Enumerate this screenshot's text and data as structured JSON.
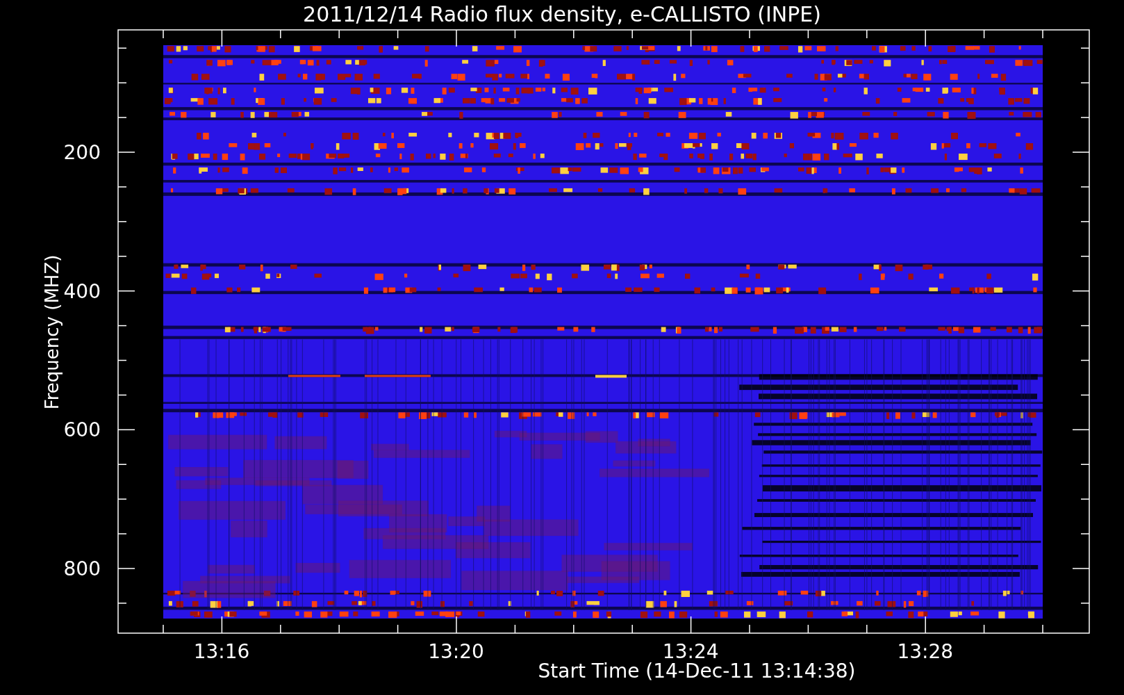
{
  "title": "2011/12/14  Radio flux density, e-CALLISTO (INPE)",
  "y_axis": {
    "label": "Frequency (MHZ)",
    "ticks": [
      "200",
      "400",
      "600",
      "800"
    ]
  },
  "x_axis": {
    "label": "Start Time (14-Dec-11 13:14:38)",
    "ticks": [
      "13:16",
      "13:20",
      "13:24",
      "13:28"
    ]
  }
}
